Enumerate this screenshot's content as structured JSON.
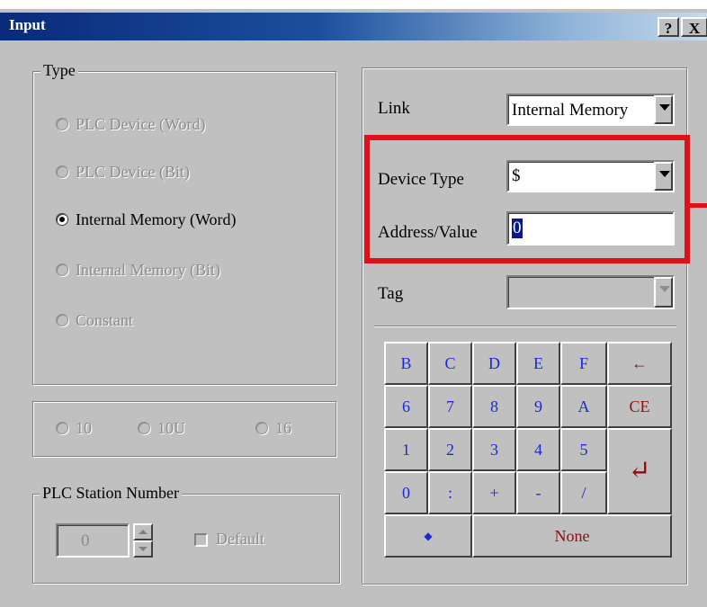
{
  "window": {
    "title": "Input",
    "help_label": "?",
    "close_label": "X"
  },
  "type_group": {
    "legend": "Type",
    "options": [
      {
        "label": "PLC Device (Word)",
        "selected": false,
        "enabled": false
      },
      {
        "label": "PLC Device (Bit)",
        "selected": false,
        "enabled": false
      },
      {
        "label": "Internal Memory (Word)",
        "selected": true,
        "enabled": true
      },
      {
        "label": "Internal Memory (Bit)",
        "selected": false,
        "enabled": false
      },
      {
        "label": "Constant",
        "selected": false,
        "enabled": false
      }
    ]
  },
  "format_group": {
    "options": [
      {
        "label": "10",
        "selected": false,
        "enabled": false
      },
      {
        "label": "10U",
        "selected": false,
        "enabled": false
      },
      {
        "label": "16",
        "selected": false,
        "enabled": false
      }
    ]
  },
  "station_group": {
    "legend": "PLC Station Number",
    "value": "0",
    "default_label": "Default",
    "default_checked": false
  },
  "fields": {
    "link_label": "Link",
    "link_value": "Internal Memory",
    "device_type_label": "Device Type",
    "device_type_value": "$",
    "address_label": "Address/Value",
    "address_value": "0",
    "tag_label": "Tag",
    "tag_value": ""
  },
  "keypad": {
    "rows": [
      [
        "B",
        "C",
        "D",
        "E",
        "F",
        "←"
      ],
      [
        "6",
        "7",
        "8",
        "9",
        "A",
        "CE"
      ],
      [
        "1",
        "2",
        "3",
        "4",
        "5"
      ],
      [
        "0",
        ":",
        "+",
        "-",
        "/"
      ]
    ],
    "enter_symbol": "↵",
    "dot_label": "◆",
    "none_label": "None"
  },
  "colors": {
    "highlight": "#e0101a",
    "key_text": "#1a2ad0",
    "special_key_text": "#8b1010"
  }
}
